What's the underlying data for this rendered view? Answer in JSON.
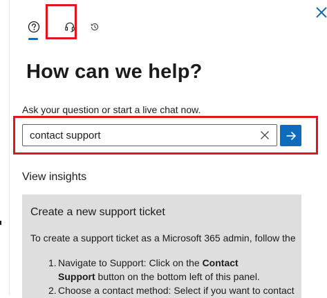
{
  "panel": {
    "close_icon": "close-icon",
    "tabs": [
      {
        "name": "help",
        "icon": "question-circle-icon",
        "selected": true
      },
      {
        "name": "support",
        "icon": "headset-icon",
        "selected": false
      },
      {
        "name": "history",
        "icon": "history-icon",
        "selected": false
      }
    ],
    "title": "How can we help?",
    "prompt": "Ask your question or start a live chat now.",
    "search": {
      "value": "contact support",
      "placeholder": "",
      "clear_icon": "clear-icon",
      "submit_icon": "arrow-right-icon"
    },
    "insights_label": "View insights",
    "card": {
      "title": "Create a new support ticket",
      "intro": "To create a support ticket as a Microsoft 365 admin, follow the",
      "steps": [
        {
          "number": "1.",
          "text_a": "Navigate to Support: Click on the ",
          "bold_a": "Contact",
          "bold_b": "Support",
          "text_b": " button on the bottom left of this panel."
        },
        {
          "number": "2.",
          "text": "Choose a contact method: Select if you want to contact"
        }
      ]
    }
  },
  "colors": {
    "accent": "#0f6cbd",
    "highlight": "#e0161b",
    "card_bg": "#dedede",
    "text": "#1b1b1b"
  }
}
